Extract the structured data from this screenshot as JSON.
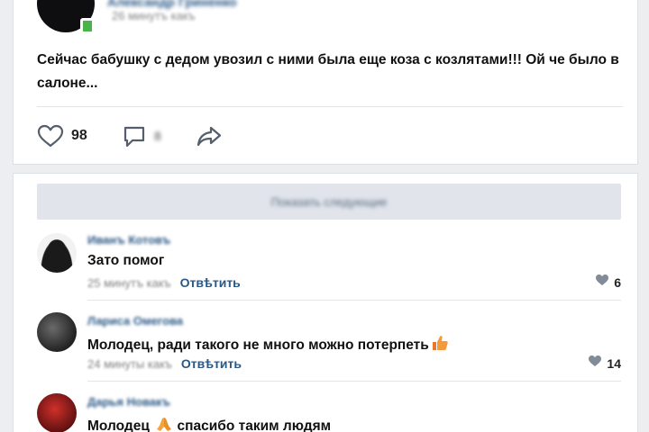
{
  "colors": {
    "link": "#2a5885",
    "meta": "#828282",
    "background": "#edeef0",
    "show_more_bg": "#e1e5eb",
    "online": "#4bb34b"
  },
  "post": {
    "author": "Александр Гриненко",
    "time": "26 минутъ какъ",
    "text": "Сейчас бабушку с дедом увозил с ними была еще коза с козлятами!!! Ой че было в салоне...",
    "actions": {
      "like_icon": "heart-icon",
      "like_count": "98",
      "comment_icon": "comment-icon",
      "comment_count": "8",
      "share_icon": "share-icon"
    }
  },
  "comments": {
    "show_more_label": "Показать следующие",
    "reply_label": "Отвѣтить",
    "items": [
      {
        "author": "Иванъ Котовъ",
        "text": "Зато помог",
        "time": "25 минутъ какъ",
        "likes": "6"
      },
      {
        "author": "Лариса Омегова",
        "text": "Молодец, ради такого не много можно потерпеть",
        "emoji": "thumbs-up-icon",
        "time": "24 минуты какъ",
        "likes": "14"
      },
      {
        "author": "Дарья Новакъ",
        "text_before": "Молодец",
        "emoji": "praying-hands-icon",
        "text_after": "спасибо таким людям"
      }
    ]
  }
}
